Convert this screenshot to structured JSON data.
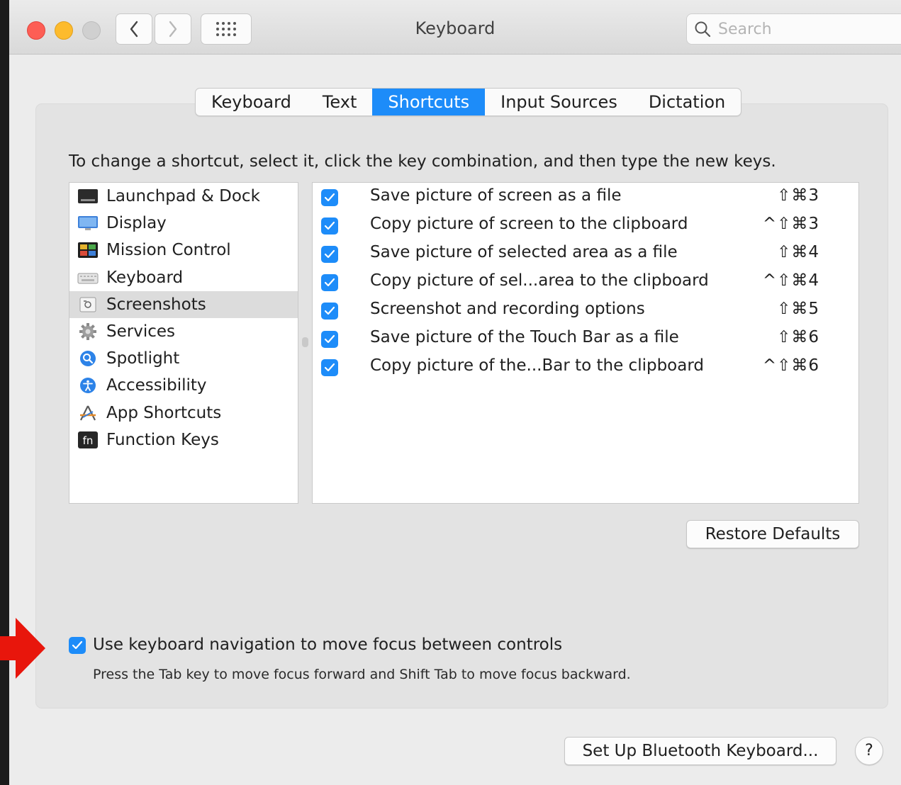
{
  "window": {
    "title": "Keyboard",
    "search_placeholder": "Search"
  },
  "tabs": [
    {
      "label": "Keyboard",
      "active": false
    },
    {
      "label": "Text",
      "active": false
    },
    {
      "label": "Shortcuts",
      "active": true
    },
    {
      "label": "Input Sources",
      "active": false
    },
    {
      "label": "Dictation",
      "active": false
    }
  ],
  "instructions": "To change a shortcut, select it, click the key combination, and then type the new keys.",
  "categories": [
    {
      "label": "Launchpad & Dock",
      "icon": "launchpad-dock-icon"
    },
    {
      "label": "Display",
      "icon": "display-icon"
    },
    {
      "label": "Mission Control",
      "icon": "mission-control-icon"
    },
    {
      "label": "Keyboard",
      "icon": "keyboard-icon"
    },
    {
      "label": "Screenshots",
      "icon": "screenshots-icon",
      "selected": true
    },
    {
      "label": "Services",
      "icon": "services-gear-icon"
    },
    {
      "label": "Spotlight",
      "icon": "spotlight-icon"
    },
    {
      "label": "Accessibility",
      "icon": "accessibility-icon"
    },
    {
      "label": "App Shortcuts",
      "icon": "app-shortcuts-icon"
    },
    {
      "label": "Function Keys",
      "icon": "function-keys-icon",
      "icon_text": "fn"
    }
  ],
  "shortcuts": [
    {
      "label": "Save picture of screen as a file",
      "keys": "⇧⌘3",
      "checked": true
    },
    {
      "label": "Copy picture of screen to the clipboard",
      "keys": "^⇧⌘3",
      "checked": true
    },
    {
      "label": "Save picture of selected area as a file",
      "keys": "⇧⌘4",
      "checked": true
    },
    {
      "label": "Copy picture of sel...area to the clipboard",
      "keys": "^⇧⌘4",
      "checked": true
    },
    {
      "label": "Screenshot and recording options",
      "keys": "⇧⌘5",
      "checked": true
    },
    {
      "label": "Save picture of the Touch Bar as a file",
      "keys": "⇧⌘6",
      "checked": true
    },
    {
      "label": "Copy picture of the...Bar to the clipboard",
      "keys": "^⇧⌘6",
      "checked": true
    }
  ],
  "buttons": {
    "restore_defaults": "Restore Defaults",
    "bluetooth": "Set Up Bluetooth Keyboard...",
    "help": "?"
  },
  "keyboard_navigation": {
    "checked": true,
    "label": "Use keyboard navigation to move focus between controls",
    "description": "Press the Tab key to move focus forward and Shift Tab to move focus backward."
  },
  "colors": {
    "accent": "#1d8cf9",
    "close": "#fd5e55",
    "minimize": "#fdbb2d",
    "annotation_arrow": "#e8160c"
  }
}
